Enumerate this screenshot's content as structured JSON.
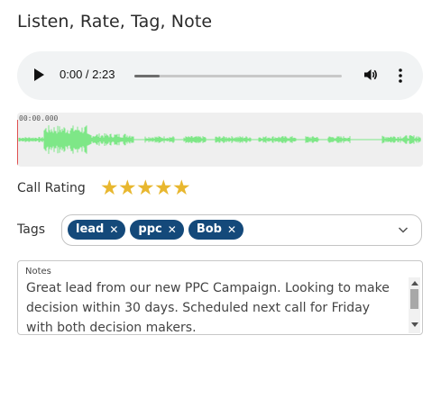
{
  "header": {
    "title": "Listen, Rate, Tag, Note"
  },
  "player": {
    "time": "0:00 / 2:23",
    "progress": 0.12,
    "icons": {
      "play": "play-icon",
      "volume": "volume-icon",
      "more": "more-vert-icon"
    }
  },
  "waveform": {
    "time_label": "00:00.000",
    "color": "#7ee787"
  },
  "rating": {
    "label": "Call Rating",
    "value": 5,
    "max": 5,
    "star_color": "#e8b72f"
  },
  "tags": {
    "label": "Tags",
    "items": [
      "lead",
      "ppc",
      "Bob"
    ],
    "chip_color": "#14497a",
    "icons": {
      "remove": "close-icon",
      "dropdown": "chevron-down-icon"
    }
  },
  "notes": {
    "label": "Notes",
    "text": "Great lead from our new PPC Campaign.  Looking to make decision within 30 days.  Scheduled next call for Friday with both decision makers."
  }
}
